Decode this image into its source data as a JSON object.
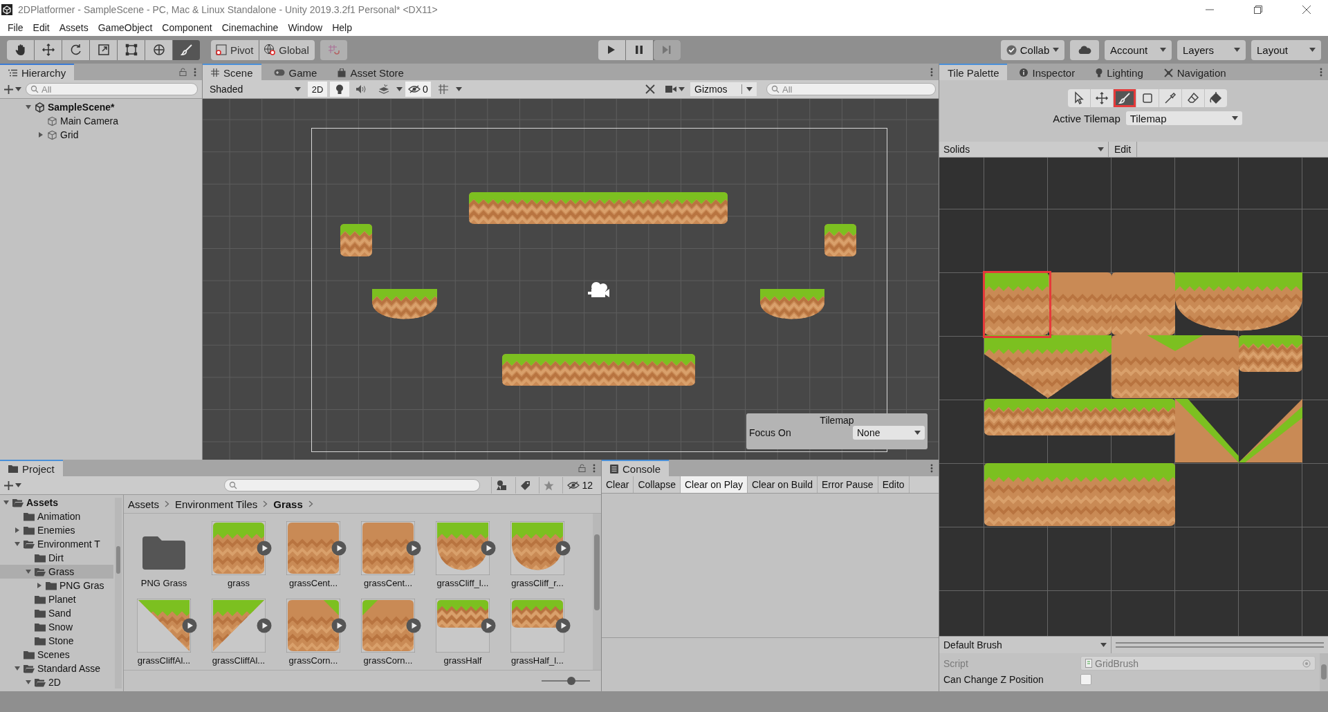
{
  "window": {
    "title": "2DPlatformer - SampleScene - PC, Mac & Linux Standalone - Unity 2019.3.2f1 Personal* <DX11>"
  },
  "menu": [
    "File",
    "Edit",
    "Assets",
    "GameObject",
    "Component",
    "Cinemachine",
    "Window",
    "Help"
  ],
  "toolbar": {
    "tools": [
      {
        "kind": "hand",
        "selected": false
      },
      {
        "kind": "move",
        "selected": false
      },
      {
        "kind": "rotate",
        "selected": false
      },
      {
        "kind": "scale",
        "selected": false
      },
      {
        "kind": "rect",
        "selected": false
      },
      {
        "kind": "transform",
        "selected": false
      },
      {
        "kind": "brush",
        "selected": true
      }
    ],
    "pivot": "Pivot",
    "global": "Global",
    "collab": "Collab",
    "account": "Account",
    "layers": "Layers",
    "layout": "Layout"
  },
  "hierarchy": {
    "tab": "Hierarchy",
    "search_placeholder": "All",
    "tree": [
      {
        "label": "SampleScene*",
        "kind": "scene",
        "selected": false,
        "expanded": true,
        "children": [
          {
            "label": "Main Camera",
            "kind": "object",
            "selected": false
          },
          {
            "label": "Grid",
            "kind": "object",
            "selected": false,
            "expanded": false
          }
        ]
      }
    ]
  },
  "scene": {
    "tabs": [
      {
        "label": "Scene",
        "kind": "scene",
        "selected": true
      },
      {
        "label": "Game",
        "kind": "game",
        "selected": false
      },
      {
        "label": "Asset Store",
        "kind": "store",
        "selected": false
      }
    ],
    "shading": "Shaded",
    "toggles": [
      {
        "kind": "mode",
        "label": "2D",
        "on": true
      },
      {
        "kind": "light",
        "on": true
      },
      {
        "kind": "audio",
        "on": false
      },
      {
        "kind": "effects",
        "on": false
      }
    ],
    "hidden_count": "0",
    "gizmos": "Gizmos",
    "search_placeholder": "All",
    "overlay": {
      "title": "Tilemap",
      "focus_label": "Focus On",
      "focus_value": "None"
    }
  },
  "tile_palette": {
    "tabs": [
      {
        "label": "Tile Palette",
        "kind": "palette",
        "selected": true
      },
      {
        "label": "Inspector",
        "kind": "info",
        "selected": false
      },
      {
        "label": "Lighting",
        "kind": "bulb",
        "selected": false
      },
      {
        "label": "Navigation",
        "kind": "nav",
        "selected": false
      }
    ],
    "tools": [
      {
        "kind": "select",
        "selected": false
      },
      {
        "kind": "move",
        "selected": false
      },
      {
        "kind": "brush",
        "selected": true
      },
      {
        "kind": "box",
        "selected": false
      },
      {
        "kind": "picker",
        "selected": false
      },
      {
        "kind": "eraser",
        "selected": false
      },
      {
        "kind": "fill",
        "selected": false
      }
    ],
    "active_tilemap_label": "Active Tilemap",
    "active_tilemap": "Tilemap",
    "palette": "Solids",
    "edit": "Edit",
    "brush": "Default Brush",
    "fields": [
      {
        "label": "Script",
        "kind": "object",
        "value": "GridBrush"
      },
      {
        "label": "Can Change Z Position",
        "kind": "checkbox",
        "checked": false
      }
    ]
  },
  "project": {
    "tab": "Project",
    "hidden_count": "12",
    "tree": [
      {
        "label": "Assets",
        "selected": false,
        "expanded": true,
        "children": [
          {
            "label": "Animation",
            "selected": false
          },
          {
            "label": "Enemies",
            "selected": false,
            "expanded": false
          },
          {
            "label": "Environment T",
            "selected": false,
            "expanded": true,
            "children": [
              {
                "label": "Dirt",
                "selected": false
              },
              {
                "label": "Grass",
                "selected": true,
                "expanded": true,
                "children": [
                  {
                    "label": "PNG Gras",
                    "selected": false,
                    "expanded": false
                  }
                ]
              },
              {
                "label": "Planet",
                "selected": false
              },
              {
                "label": "Sand",
                "selected": false
              },
              {
                "label": "Snow",
                "selected": false
              },
              {
                "label": "Stone",
                "selected": false
              }
            ]
          },
          {
            "label": "Scenes",
            "selected": false
          },
          {
            "label": "Standard Asse",
            "selected": false,
            "expanded": true,
            "children": [
              {
                "label": "2D",
                "selected": false,
                "expanded": true
              }
            ]
          }
        ]
      }
    ],
    "breadcrumb": [
      "Assets",
      "Environment Tiles",
      "Grass"
    ],
    "assets": [
      {
        "name": "PNG Grass",
        "kind": "folder"
      },
      {
        "name": "grass",
        "kind": "sprite"
      },
      {
        "name": "grassCent...",
        "kind": "sprite"
      },
      {
        "name": "grassCent...",
        "kind": "sprite"
      },
      {
        "name": "grassCliff_l...",
        "kind": "sprite"
      },
      {
        "name": "grassCliff_r...",
        "kind": "sprite"
      },
      {
        "name": "grassCliffAl...",
        "kind": "sprite"
      },
      {
        "name": "grassCliffAl...",
        "kind": "sprite"
      },
      {
        "name": "grassCorn...",
        "kind": "sprite"
      },
      {
        "name": "grassCorn...",
        "kind": "sprite"
      },
      {
        "name": "grassHalf",
        "kind": "sprite"
      },
      {
        "name": "grassHalf_l...",
        "kind": "sprite"
      }
    ],
    "thumbnail_size": {
      "level": 0.62
    }
  },
  "console": {
    "tab": "Console",
    "buttons": [
      {
        "label": "Clear",
        "selected": false
      },
      {
        "label": "Collapse",
        "selected": false
      },
      {
        "label": "Clear on Play",
        "selected": true
      },
      {
        "label": "Clear on Build",
        "selected": false
      },
      {
        "label": "Error Pause",
        "selected": false
      },
      {
        "label": "Edito",
        "selected": false
      }
    ]
  }
}
